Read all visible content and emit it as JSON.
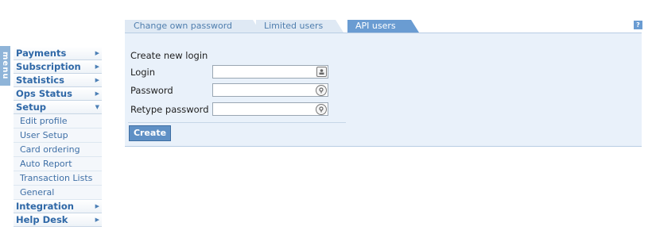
{
  "menu_label": "menu",
  "sidebar": {
    "items": [
      {
        "label": "Payments"
      },
      {
        "label": "Subscription"
      },
      {
        "label": "Statistics"
      },
      {
        "label": "Ops Status"
      },
      {
        "label": "Setup",
        "expanded": true,
        "children": [
          {
            "label": "Edit profile"
          },
          {
            "label": "User Setup"
          },
          {
            "label": "Card ordering"
          },
          {
            "label": "Auto Report"
          },
          {
            "label": "Transaction Lists"
          },
          {
            "label": "General"
          }
        ]
      },
      {
        "label": "Integration"
      },
      {
        "label": "Help Desk"
      }
    ]
  },
  "tabs": [
    {
      "label": "Change own password",
      "active": false
    },
    {
      "label": "Limited users",
      "active": false
    },
    {
      "label": "API users",
      "active": true
    }
  ],
  "help": {
    "label": "?"
  },
  "form": {
    "title": "Create new login",
    "fields": [
      {
        "label": "Login",
        "value": "",
        "icon": "contact-card-icon"
      },
      {
        "label": "Password",
        "value": "",
        "icon": "key-lock-icon"
      },
      {
        "label": "Retype password",
        "value": "",
        "icon": "key-lock-icon"
      }
    ],
    "submit_label": "Create"
  },
  "colors": {
    "accent": "#6a9cd2",
    "panel_bg": "#e9f1fa",
    "menu_text": "#2f68a7",
    "inactive_tab_bg": "#dfe9f4"
  }
}
